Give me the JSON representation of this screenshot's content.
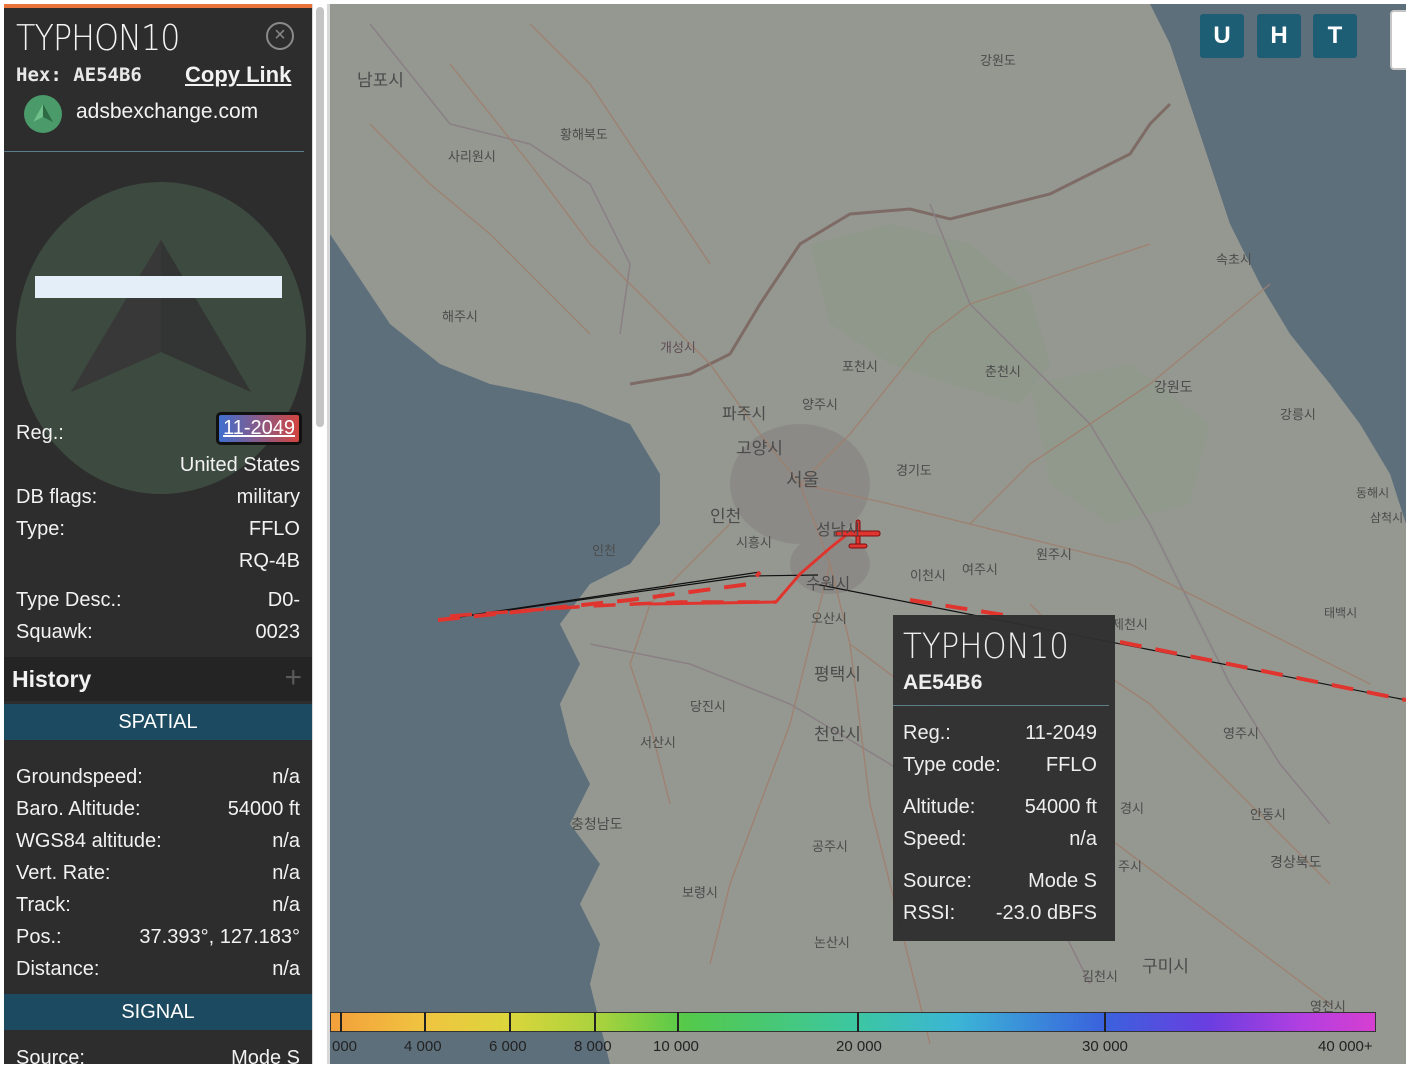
{
  "sidebar": {
    "callsign": "TYPHON10",
    "hex_label": "Hex:",
    "hex": "AE54B6",
    "copy_link": "Copy Link",
    "site": "adsbexchange.com",
    "reg_label": "Reg.:",
    "reg": "11-2049",
    "country": "United States",
    "db_flags_label": "DB flags:",
    "db_flags": "military",
    "type_label": "Type:",
    "type_code": "FFLO",
    "type_model": "RQ-4B",
    "type_desc_label": "Type Desc.:",
    "type_desc": "D0-",
    "squawk_label": "Squawk:",
    "squawk": "0023",
    "history_label": "History",
    "spatial_label": "SPATIAL",
    "groundspeed_label": "Groundspeed:",
    "groundspeed": "n/a",
    "baro_alt_label": "Baro. Altitude:",
    "baro_alt": "54000 ft",
    "wgs84_label": "WGS84 altitude:",
    "wgs84": "n/a",
    "vert_rate_label": "Vert. Rate:",
    "vert_rate": "n/a",
    "track_label": "Track:",
    "track": "n/a",
    "pos_label": "Pos.:",
    "pos": "37.393°, 127.183°",
    "distance_label": "Distance:",
    "distance": "n/a",
    "signal_label": "SIGNAL",
    "source_label": "Source:",
    "source": "Mode S"
  },
  "map_buttons": [
    "U",
    "H",
    "T"
  ],
  "map_labels": [
    "남포시",
    "강원도",
    "황해북도",
    "사리원시",
    "해주시",
    "개성시",
    "포천시",
    "춘천시",
    "강원도",
    "속초시",
    "강릉시",
    "파주시",
    "양주시",
    "고양시",
    "서울",
    "경기도",
    "인천",
    "인천",
    "시흥시",
    "성남시",
    "이천시",
    "여주시",
    "원주시",
    "동해시",
    "삼척시",
    "태백시",
    "수원시",
    "오산시",
    "평택시",
    "당진시",
    "서산시",
    "천안시",
    "충청남도",
    "공주시",
    "보령시",
    "논산시",
    "영주시",
    "안동시",
    "경상북도",
    "구미시",
    "김천시",
    "영천시",
    "제천시",
    "경시",
    "주시"
  ],
  "tooltip": {
    "callsign": "TYPHON10",
    "hex": "AE54B6",
    "reg_label": "Reg.:",
    "reg": "11-2049",
    "type_label": "Type code:",
    "type": "FFLO",
    "alt_label": "Altitude:",
    "alt": "54000 ft",
    "speed_label": "Speed:",
    "speed": "n/a",
    "source_label": "Source:",
    "source": "Mode S",
    "rssi_label": "RSSI:",
    "rssi": "-23.0 dBFS"
  },
  "altitude_legend": [
    "000",
    "4 000",
    "6 000",
    "8 000",
    "10 000",
    "20 000",
    "30 000",
    "40 000+"
  ],
  "colors": {
    "panel_bg": "#2d2d2d",
    "section_bar": "#1c4a60",
    "button": "#1e5e74",
    "track": "#e0352f",
    "accent": "#e8743b"
  }
}
